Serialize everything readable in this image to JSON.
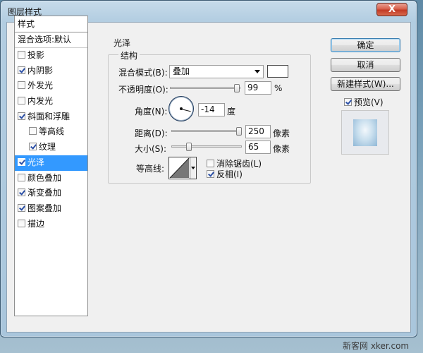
{
  "window": {
    "title": "图层样式",
    "close_glyph": "X"
  },
  "styles_list": {
    "header": "样式",
    "blending": "混合选项:默认",
    "items": [
      {
        "label": "投影",
        "checked": false,
        "indent": false,
        "selected": false
      },
      {
        "label": "内阴影",
        "checked": true,
        "indent": false,
        "selected": false
      },
      {
        "label": "外发光",
        "checked": false,
        "indent": false,
        "selected": false
      },
      {
        "label": "内发光",
        "checked": false,
        "indent": false,
        "selected": false
      },
      {
        "label": "斜面和浮雕",
        "checked": true,
        "indent": false,
        "selected": false
      },
      {
        "label": "等高线",
        "checked": false,
        "indent": true,
        "selected": false
      },
      {
        "label": "纹理",
        "checked": true,
        "indent": true,
        "selected": false
      },
      {
        "label": "光泽",
        "checked": true,
        "indent": false,
        "selected": true
      },
      {
        "label": "颜色叠加",
        "checked": false,
        "indent": false,
        "selected": false
      },
      {
        "label": "渐变叠加",
        "checked": true,
        "indent": false,
        "selected": false
      },
      {
        "label": "图案叠加",
        "checked": true,
        "indent": false,
        "selected": false
      },
      {
        "label": "描边",
        "checked": false,
        "indent": false,
        "selected": false
      }
    ]
  },
  "satin": {
    "section_title": "光泽",
    "structure_title": "结构",
    "blend_mode_label": "混合模式(B):",
    "blend_mode_value": "叠加",
    "color_hex": "#ffffff",
    "opacity_label": "不透明度(O):",
    "opacity_value": "99",
    "opacity_unit": "%",
    "opacity_level": 0.99,
    "angle_label": "角度(N):",
    "angle_value": "-14",
    "angle_unit": "度",
    "distance_label": "距离(D):",
    "distance_value": "250",
    "distance_unit": "像素",
    "distance_level": 1.0,
    "size_label": "大小(S):",
    "size_value": "65",
    "size_unit": "像素",
    "size_level": 0.26,
    "contour_label": "等高线:",
    "antialias_label": "消除锯齿(L)",
    "antialias_checked": false,
    "invert_label": "反相(I)",
    "invert_checked": true
  },
  "actions": {
    "ok": "确定",
    "cancel": "取消",
    "new_style": "新建样式(W)...",
    "preview_label": "预览(V)",
    "preview_checked": true
  },
  "watermark": "新客网 xker.com"
}
